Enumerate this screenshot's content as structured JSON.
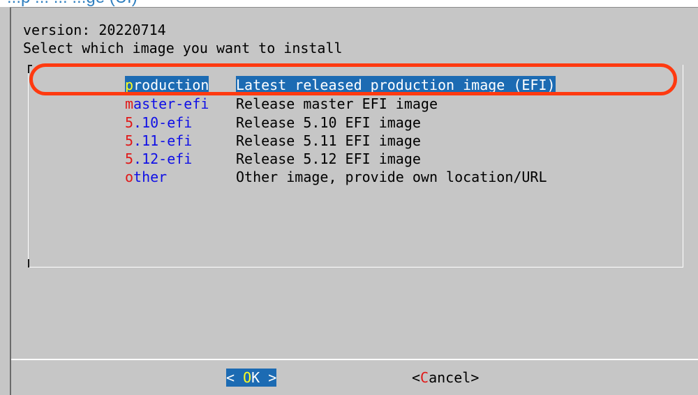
{
  "page_header": {
    "partial_title": "...p ... ... ...ge (UI)"
  },
  "dialog": {
    "version_text": "version: 20220714",
    "prompt_text": "Select which image you want to install",
    "items": [
      {
        "tag_first": "p",
        "tag_rest": "roduction",
        "description": "Latest released production image (EFI)",
        "selected": true
      },
      {
        "tag_first": "m",
        "tag_rest": "aster-efi",
        "description": "Release master EFI image",
        "selected": false
      },
      {
        "tag_first": "5",
        "tag_rest": ".10-efi",
        "description": "Release 5.10 EFI image",
        "selected": false
      },
      {
        "tag_first": "5",
        "tag_rest": ".11-efi",
        "description": "Release 5.11 EFI image",
        "selected": false
      },
      {
        "tag_first": "5",
        "tag_rest": ".12-efi",
        "description": "Release 5.12 EFI image",
        "selected": false
      },
      {
        "tag_first": "o",
        "tag_rest": "ther",
        "description": "Other image, provide own location/URL",
        "selected": false
      }
    ],
    "buttons": {
      "ok": {
        "left": "< ",
        "hot": "O",
        "rest": "K",
        "right": " >"
      },
      "cancel": {
        "left": "<",
        "hot": "C",
        "rest": "ancel",
        "right": ">"
      }
    }
  },
  "colors": {
    "dialog_background": "#c6c6c6",
    "selection_background": "#1c6bb3",
    "tag_text": "#1010e6",
    "hotkey": "#e01818",
    "selected_hotkey": "#ffff20",
    "annotation_ring": "#ff3a10"
  }
}
